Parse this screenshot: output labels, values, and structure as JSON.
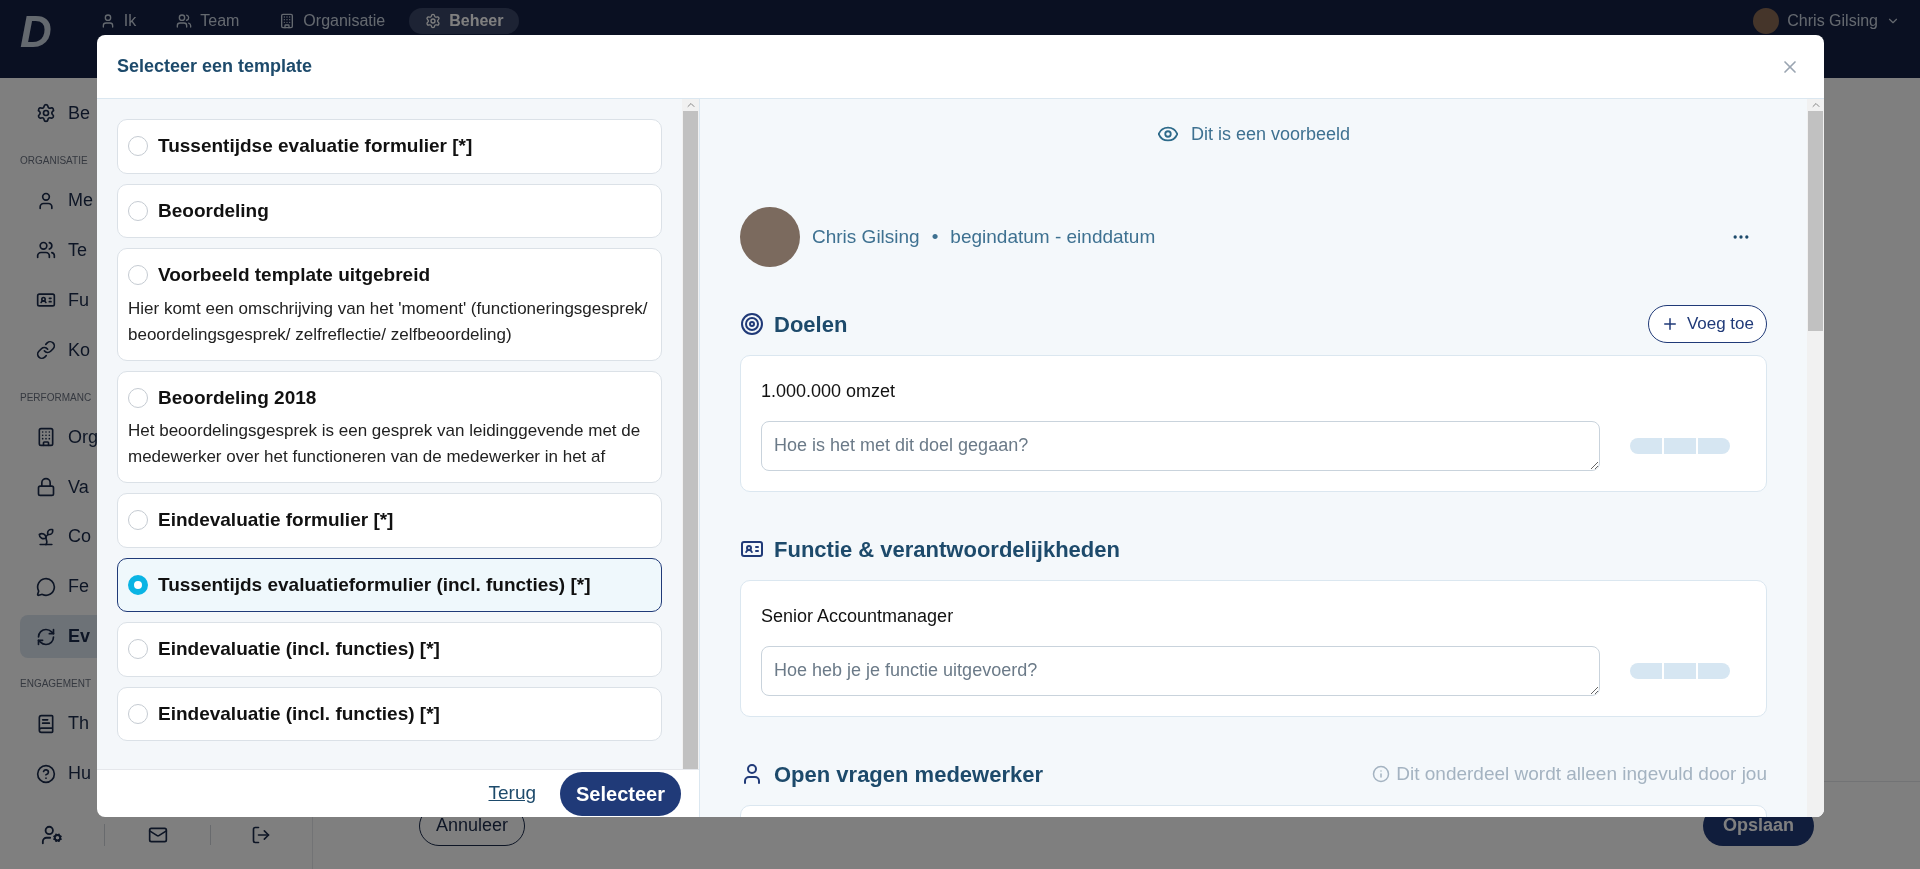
{
  "nav": {
    "logo": "D",
    "items": [
      {
        "label": "Ik",
        "selected": false
      },
      {
        "label": "Team",
        "selected": false
      },
      {
        "label": "Organisatie",
        "selected": false
      },
      {
        "label": "Beheer",
        "selected": true
      }
    ],
    "user": "Chris Gilsing"
  },
  "sidebar": {
    "items": [
      {
        "kind": "item",
        "label": "Be",
        "selected": false
      },
      {
        "kind": "section",
        "label": "ORGANISATIE"
      },
      {
        "kind": "item",
        "label": "Me",
        "selected": false
      },
      {
        "kind": "item",
        "label": "Te",
        "selected": false
      },
      {
        "kind": "item",
        "label": "Fu",
        "selected": false
      },
      {
        "kind": "item",
        "label": "Ko",
        "selected": false
      },
      {
        "kind": "section",
        "label": "PERFORMANC"
      },
      {
        "kind": "item",
        "label": "Org",
        "selected": false
      },
      {
        "kind": "item",
        "label": "Va",
        "selected": false
      },
      {
        "kind": "item",
        "label": "Co",
        "selected": false
      },
      {
        "kind": "item",
        "label": "Fe",
        "selected": false
      },
      {
        "kind": "item",
        "label": "Ev",
        "selected": true
      },
      {
        "kind": "section",
        "label": "ENGAGEMENT"
      },
      {
        "kind": "item",
        "label": "Th",
        "selected": false
      },
      {
        "kind": "item",
        "label": "Hu",
        "selected": false
      }
    ]
  },
  "footer": {
    "cancel": "Annuleer",
    "save": "Opslaan"
  },
  "modal": {
    "title": "Selecteer een template",
    "templates": [
      {
        "title": "Tussentijdse evaluatie formulier [*]",
        "selected": false
      },
      {
        "title": "Beoordeling",
        "selected": false
      },
      {
        "title": "Voorbeeld template uitgebreid",
        "description": "Hier komt een omschrijving van het 'moment' (functioneringsgesprek/ beoordelingsgesprek/ zelfreflectie/ zelfbeoordeling)",
        "selected": false
      },
      {
        "title": "Beoordeling 2018",
        "description": "Het beoordelingsgesprek is een gesprek van leidinggevende met de medewerker over het functioneren van de medewerker in het af",
        "selected": false
      },
      {
        "title": "Eindevaluatie formulier [*]",
        "selected": false
      },
      {
        "title": "Tussentijds evaluatieformulier (incl. functies) [*]",
        "selected": true
      },
      {
        "title": "Eindevaluatie (incl. functies) [*]",
        "selected": false
      },
      {
        "title": "Eindevaluatie (incl. functies) [*]",
        "selected": false
      }
    ],
    "back": "Terug",
    "select": "Selecteer",
    "preview": {
      "notice": "Dit is een voorbeeld",
      "person": "Chris Gilsing",
      "separator": "•",
      "period": "begindatum - einddatum",
      "sections": [
        {
          "title": "Doelen",
          "action": "Voeg toe",
          "cards": [
            {
              "text": "1.000.000 omzet",
              "placeholder": "Hoe is het met dit doel gegaan?"
            }
          ]
        },
        {
          "title": "Functie & verantwoordelijkheden",
          "cards": [
            {
              "text": "Senior Accountmanager",
              "placeholder": "Hoe heb je je functie uitgevoerd?"
            }
          ]
        },
        {
          "title": "Open vragen medewerker",
          "note": "Dit onderdeel wordt alleen ingevuld door jou"
        }
      ]
    }
  }
}
